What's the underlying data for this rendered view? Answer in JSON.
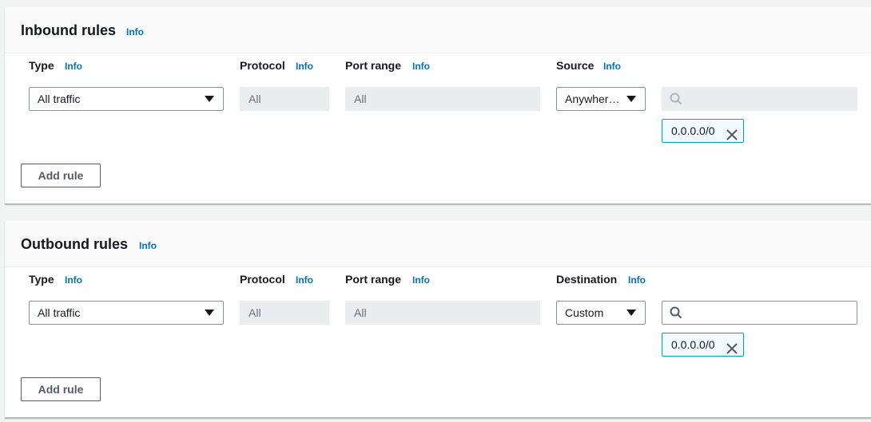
{
  "colors": {
    "info": "#0073bb",
    "token_border": "#00a1c9",
    "token_bg": "#f1faff"
  },
  "inbound": {
    "title": "Inbound rules",
    "info": "Info",
    "columns": {
      "type": "Type",
      "protocol": "Protocol",
      "port_range": "Port range",
      "source": "Source"
    },
    "row": {
      "type_value": "All traffic",
      "protocol_value": "All",
      "port_value": "All",
      "source_value": "Anywher…",
      "search_placeholder": "",
      "token": "0.0.0.0/0"
    },
    "add_rule": "Add rule"
  },
  "outbound": {
    "title": "Outbound rules",
    "info": "Info",
    "columns": {
      "type": "Type",
      "protocol": "Protocol",
      "port_range": "Port range",
      "destination": "Destination"
    },
    "row": {
      "type_value": "All traffic",
      "protocol_value": "All",
      "port_value": "All",
      "destination_value": "Custom",
      "search_placeholder": "",
      "token": "0.0.0.0/0"
    },
    "add_rule": "Add rule"
  },
  "icons": {
    "search": "search-icon",
    "close": "close-icon",
    "caret": "caret-down-icon"
  }
}
